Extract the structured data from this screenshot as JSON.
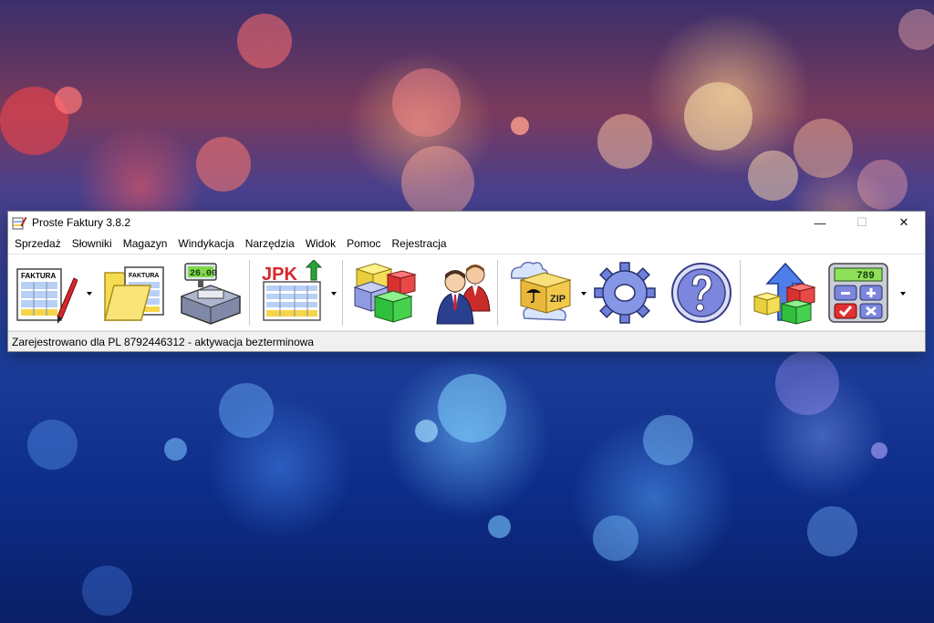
{
  "window": {
    "title": "Proste Faktury 3.8.2",
    "controls": {
      "minimize": "—",
      "maximize": "☐",
      "close": "✕"
    }
  },
  "menu": [
    "Sprzedaż",
    "Słowniki",
    "Magazyn",
    "Windykacja",
    "Narzędzia",
    "Widok",
    "Pomoc",
    "Rejestracja"
  ],
  "toolbar": {
    "invoice_label": "FAKTURA",
    "invoices_label": "FAKTURA",
    "register_display": "26.00",
    "jpk_label": "JPK",
    "zip_label": "ZIP",
    "calculator_display": "789"
  },
  "status": {
    "text": "Zarejestrowano dla PL 8792446312 - aktywacja bezterminowa"
  },
  "colors": {
    "desktop_top": "#7b3a5c",
    "desktop_bottom": "#0a1f66",
    "window_bg": "#f0f0f0"
  }
}
